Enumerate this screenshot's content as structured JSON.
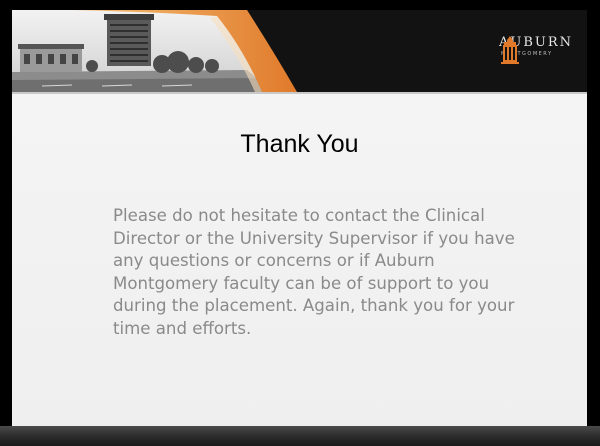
{
  "slide": {
    "title": "Thank You",
    "body": "Please do not hesitate to contact the Clinical Director or the University Supervisor if you have any questions or concerns or if Auburn Montgomery faculty can be of support to you during the placement. Again, thank you for your time and efforts."
  },
  "logo": {
    "name": "AUBURN",
    "subtitle": "MONTGOMERY",
    "icon": "tower-icon"
  },
  "colors": {
    "accent": "#e07a2a",
    "title": "#000000",
    "body_text": "#8a8a8a",
    "background": "#f2f2f2",
    "frame": "#000000"
  }
}
